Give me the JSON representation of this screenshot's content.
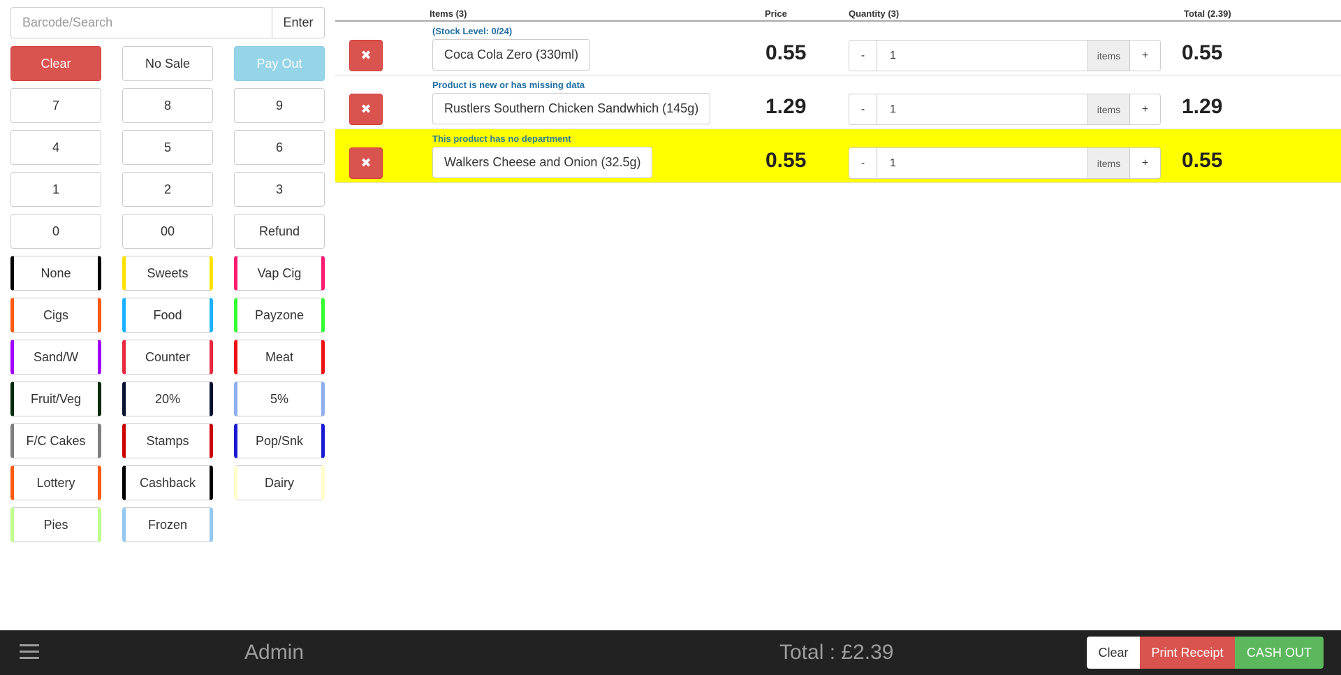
{
  "search": {
    "placeholder": "Barcode/Search",
    "enter_label": "Enter"
  },
  "keypad": [
    {
      "label": "Clear",
      "style": "clear"
    },
    {
      "label": "No Sale"
    },
    {
      "label": "Pay Out",
      "style": "payout"
    },
    {
      "label": "7"
    },
    {
      "label": "8"
    },
    {
      "label": "9"
    },
    {
      "label": "4"
    },
    {
      "label": "5"
    },
    {
      "label": "6"
    },
    {
      "label": "1"
    },
    {
      "label": "2"
    },
    {
      "label": "3"
    },
    {
      "label": "0"
    },
    {
      "label": "00"
    },
    {
      "label": "Refund"
    },
    {
      "label": "None",
      "color": "#000000"
    },
    {
      "label": "Sweets",
      "color": "#ffe200"
    },
    {
      "label": "Vap Cig",
      "color": "#ff1a6e"
    },
    {
      "label": "Cigs",
      "color": "#ff5a14"
    },
    {
      "label": "Food",
      "color": "#1ab2ff"
    },
    {
      "label": "Payzone",
      "color": "#33ff33"
    },
    {
      "label": "Sand/W",
      "color": "#a200ff"
    },
    {
      "label": "Counter",
      "color": "#e8283c"
    },
    {
      "label": "Meat",
      "color": "#ee1111"
    },
    {
      "label": "Fruit/Veg",
      "color": "#062b0b"
    },
    {
      "label": "20%",
      "color": "#081030"
    },
    {
      "label": "5%",
      "color": "#8eaef0"
    },
    {
      "label": "F/C Cakes",
      "color": "#7f7f7f"
    },
    {
      "label": "Stamps",
      "color": "#cc0000"
    },
    {
      "label": "Pop/Snk",
      "color": "#1a1ad6"
    },
    {
      "label": "Lottery",
      "color": "#ff5a14"
    },
    {
      "label": "Cashback",
      "color": "#000000"
    },
    {
      "label": "Dairy",
      "color": "#ffffcc"
    },
    {
      "label": "Pies",
      "color": "#bfff8c"
    },
    {
      "label": "Frozen",
      "color": "#94c8f0"
    }
  ],
  "cart": {
    "headers": {
      "items": "Items (3)",
      "price": "Price",
      "quantity": "Quantity (3)",
      "total": "Total (2.39)"
    },
    "rows": [
      {
        "note": "(Stock Level: 0/24)",
        "name": "Coca Cola Zero (330ml)",
        "price": "0.55",
        "qty": "1",
        "unit": "items",
        "total": "0.55",
        "highlight": false
      },
      {
        "note": "Product is new or has missing data",
        "name": "Rustlers Southern Chicken Sandwhich (145g)",
        "price": "1.29",
        "qty": "1",
        "unit": "items",
        "total": "1.29",
        "highlight": false
      },
      {
        "note": "This product has no department",
        "name": "Walkers Cheese and Onion (32.5g)",
        "price": "0.55",
        "qty": "1",
        "unit": "items",
        "total": "0.55",
        "highlight": true
      }
    ],
    "remove_glyph": "✖",
    "minus_glyph": "-",
    "plus_glyph": "+"
  },
  "bottombar": {
    "menu_icon": "hamburger-icon",
    "user": "Admin",
    "total": "Total : £2.39",
    "clear_label": "Clear",
    "print_label": "Print Receipt",
    "cashout_label": "CASH OUT"
  },
  "colors": {
    "danger": "#d9534f",
    "info": "#96d4e8",
    "success": "#5cb85c",
    "highlight": "#ffff00",
    "bar": "#222222"
  }
}
